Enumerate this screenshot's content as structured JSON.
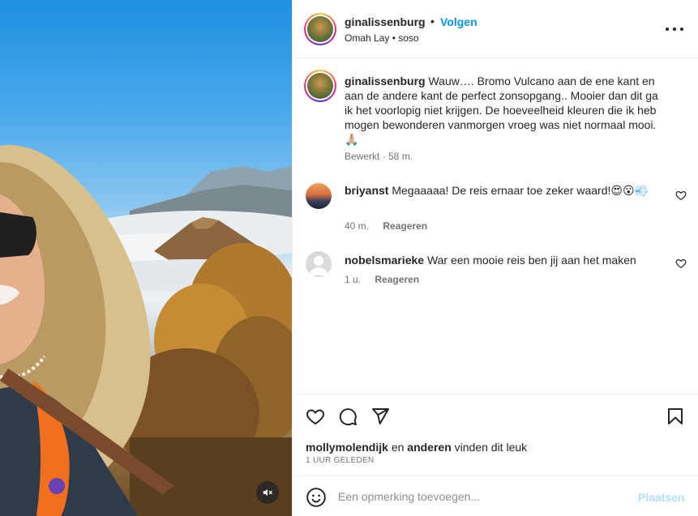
{
  "post": {
    "username": "ginalissenburg",
    "follow_label": "Volgen",
    "separator": "•",
    "subtitle": "Omah Lay • soso",
    "caption_username": "ginalissenburg",
    "caption_text": "Wauw…. Bromo Vulcano aan de ene kant en aan de andere kant de perfect zonsopgang.. Mooier dan dit ga ik het voorlopig niet krijgen. De hoeveelheid kleuren die ik heb mogen bewonderen vanmorgen vroeg was niet normaal mooi. 🙏🏼",
    "caption_meta": "Bewerkt · 58 m."
  },
  "comments": [
    {
      "username": "briyanst",
      "text": "Megaaaaa! De reis ernaar toe zeker waard!😍😮💨",
      "time": "40 m.",
      "reply_label": "Reageren"
    },
    {
      "username": "nobelsmarieke",
      "text": "War een mooie reis ben jij aan het maken",
      "time": "1 u.",
      "reply_label": "Reageren"
    }
  ],
  "likes": {
    "user": "mollymolendijk",
    "connector": "en",
    "others": "anderen",
    "suffix": "vinden dit leuk",
    "time_ago": "1 UUR GELEDEN"
  },
  "add_comment": {
    "placeholder": "Een opmerking toevoegen...",
    "post_label": "Plaatsen"
  },
  "icons": {
    "more": "more-horizontal-icon",
    "like": "heart-icon",
    "comment": "comment-bubble-icon",
    "share": "paper-plane-icon",
    "save": "bookmark-icon",
    "emoji": "smiley-icon",
    "mute": "speaker-muted-icon"
  },
  "colors": {
    "accent": "#0095f6",
    "post_button_disabled": "#b2dffc",
    "muted_text": "#737373"
  }
}
